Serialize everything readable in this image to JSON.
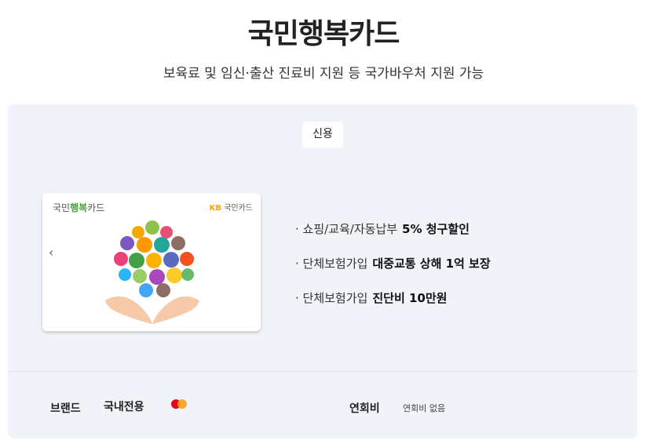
{
  "header": {
    "title": "국민행복카드",
    "subtitle": "보육료 및 임신·출산 진료비 지원 등 국가바우처 지원 가능"
  },
  "badge": "신용",
  "card": {
    "name_prefix": "국민",
    "name_highlight": "행복",
    "name_suffix": "카드",
    "issuer_mark": "KB",
    "issuer_name": "국민카드"
  },
  "benefits": [
    {
      "label": "· 쇼핑/교육/자동납부",
      "value": "5% 청구할인"
    },
    {
      "label": "· 단체보험가입",
      "value": "대중교통 상해 1억 보장"
    },
    {
      "label": "· 단체보험가입",
      "value": "진단비 10만원"
    }
  ],
  "bottom": {
    "brand_label": "브랜드",
    "brand_value": "국내전용",
    "fee_label": "연회비",
    "fee_value": "연회비 없음"
  },
  "colors": {
    "panel_bg": "#f0f3f7",
    "card_green": "#4a9b3b",
    "kb_yellow": "#f5a800",
    "mastercard_red": "#eb001b",
    "mastercard_orange": "#f79e1b"
  },
  "icons": {
    "prev": "chevron-left-icon",
    "brand_logo": "mastercard-icon"
  }
}
